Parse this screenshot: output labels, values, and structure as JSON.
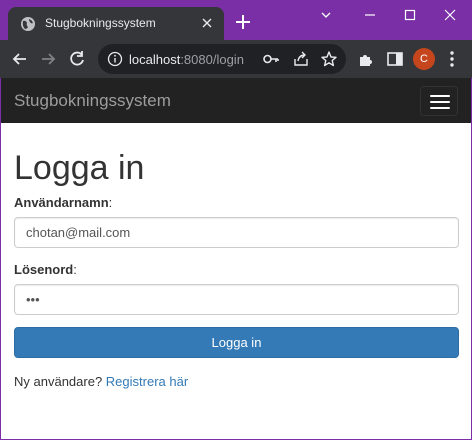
{
  "browser": {
    "tab": {
      "title": "Stugbokningssystem",
      "favicon": "globe-icon"
    },
    "omnibox": {
      "host": "localhost",
      "rest": ":8080/login"
    },
    "profile_initial": "C",
    "colors": {
      "frame": "#7b2fa6",
      "toolbar": "#35363a",
      "omnibox": "#202124",
      "avatar": "#c5451d"
    }
  },
  "navbar": {
    "brand": "Stugbokningssystem",
    "toggle_icon": "hamburger-menu-icon"
  },
  "form": {
    "title": "Logga in",
    "username_label": "Användarnamn",
    "username_value": "chotan@mail.com",
    "password_label": "Lösenord",
    "password_value": "•••",
    "submit_label": "Logga in",
    "register_prompt": "Ny användare?",
    "register_link": "Registrera här"
  },
  "colors": {
    "navbar_bg": "#222222",
    "primary": "#337ab7",
    "link": "#337ab7"
  }
}
